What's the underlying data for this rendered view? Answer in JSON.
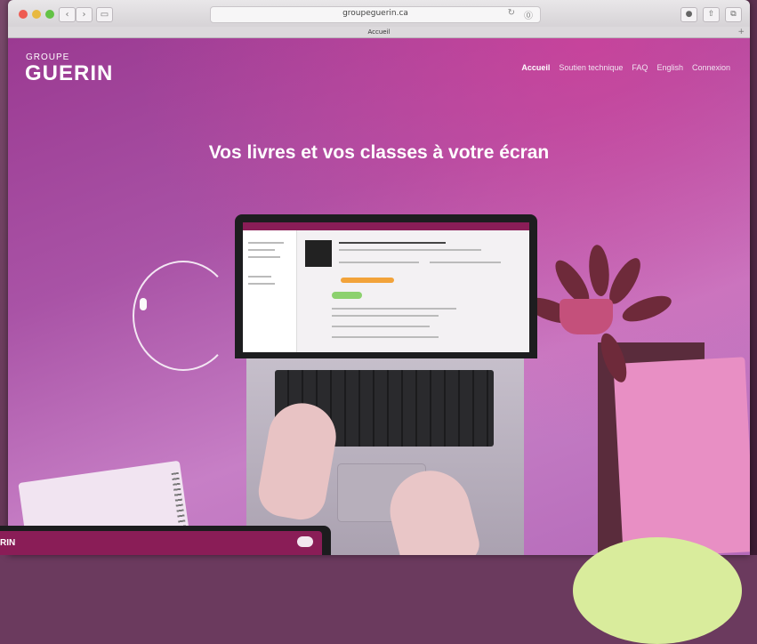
{
  "browser": {
    "address": "groupeguerin.ca",
    "tab_title": "Accueil",
    "back_glyph": "‹",
    "forward_glyph": "›",
    "sidebar_glyph": "▭",
    "reload_glyph": "↻",
    "info_glyph": "⓪",
    "tab_plus": "+"
  },
  "site": {
    "logo_small": "GROUPE",
    "logo_big": "GUERIN",
    "nav": [
      {
        "label": "Accueil",
        "active": true
      },
      {
        "label": "Soutien technique"
      },
      {
        "label": "FAQ"
      },
      {
        "label": "English"
      },
      {
        "label": "Connexion"
      }
    ],
    "hero_title": "Vos livres et vos classes à votre écran"
  },
  "overlay": {
    "logo": "RIN"
  },
  "colors": {
    "brand": "#8a1d57",
    "accent": "#f2a33a",
    "hero_gradient_start": "#9b3a92",
    "hero_gradient_end": "#c77fc6"
  }
}
